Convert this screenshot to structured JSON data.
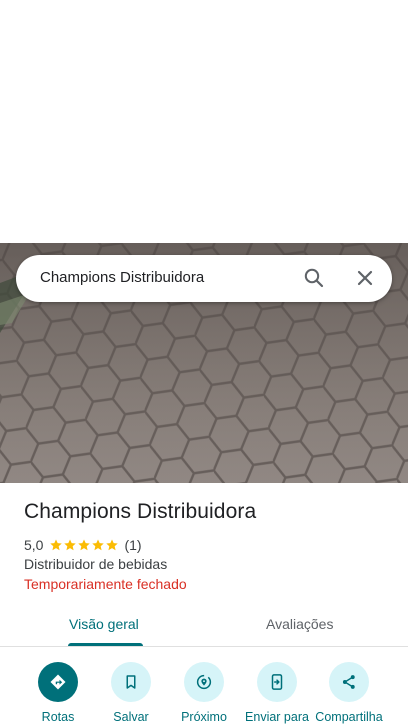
{
  "search": {
    "query": "Champions Distribuidora",
    "search_icon": "search-icon",
    "close_icon": "close-icon"
  },
  "photo": {
    "description_icon": "place-photo"
  },
  "place": {
    "name": "Champions Distribuidora",
    "rating": "5,0",
    "stars": 5,
    "review_count": "(1)",
    "category": "Distribuidor de bebidas",
    "status": "Temporariamente fechado"
  },
  "tabs": [
    {
      "label": "Visão geral",
      "selected": true
    },
    {
      "label": "Avaliações",
      "selected": false
    }
  ],
  "actions": [
    {
      "label": "Rotas",
      "icon": "directions-icon"
    },
    {
      "label": "Salvar",
      "icon": "bookmark-icon"
    },
    {
      "label": "Próximo",
      "icon": "nearby-icon"
    },
    {
      "label": "Enviar para",
      "icon": "send-to-phone-icon"
    },
    {
      "label": "Compartilha",
      "icon": "share-icon"
    }
  ],
  "colors": {
    "accent": "#00707a",
    "accent_light": "#d6f4f8",
    "status_closed": "#d93025",
    "star": "#fbbc04"
  }
}
